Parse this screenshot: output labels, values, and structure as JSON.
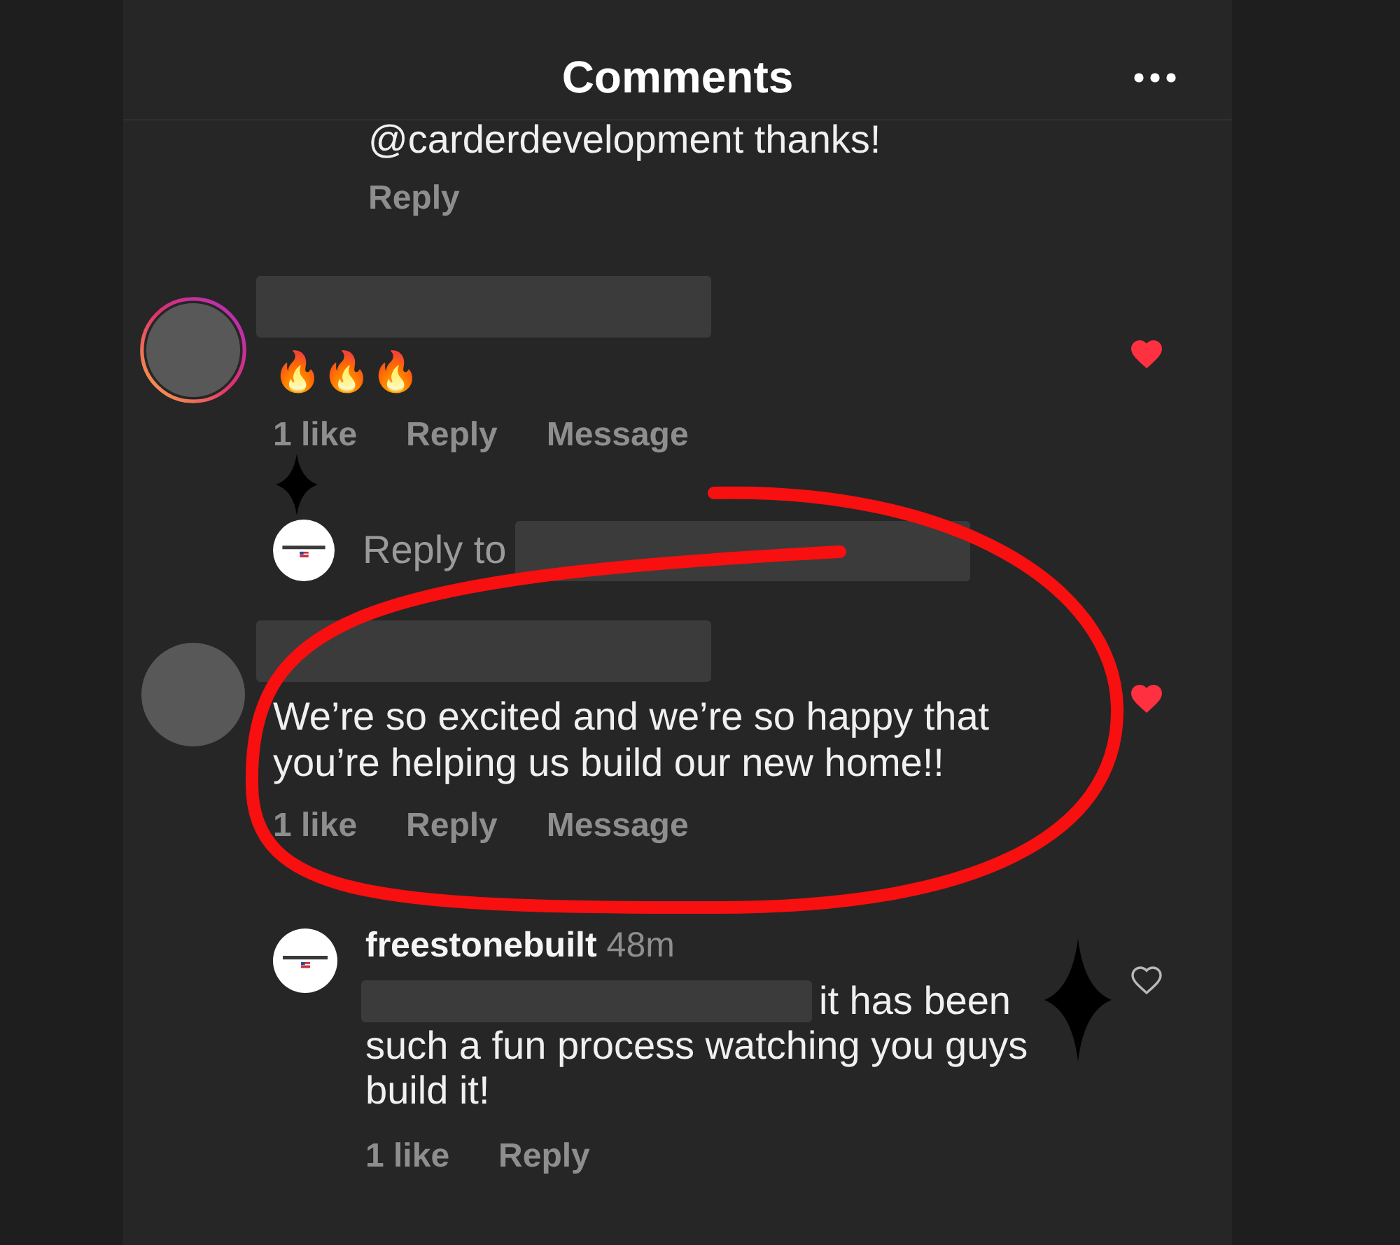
{
  "header": {
    "title": "Comments"
  },
  "comments": [
    {
      "kind": "reply_tail",
      "text": "@carderdevelopment thanks!",
      "actions": [
        "Reply"
      ]
    },
    {
      "kind": "comment",
      "author_hidden": true,
      "story_ring": true,
      "text": "🔥🔥🔥",
      "liked": true,
      "actions": [
        "1 like",
        "Reply",
        "Message"
      ]
    },
    {
      "kind": "reply_prompt",
      "label": "Reply to",
      "target_hidden": true
    },
    {
      "kind": "comment",
      "author_hidden": true,
      "story_ring": false,
      "text": "We’re so excited and we’re so happy that you’re helping us build our new home!!",
      "liked": true,
      "actions": [
        "1 like",
        "Reply",
        "Message"
      ]
    },
    {
      "kind": "reply",
      "author": "freestonebuilt",
      "time": "48m",
      "mention_hidden": true,
      "text": "it has been such a fun process watching you guys build it!",
      "liked": false,
      "actions": [
        "1 like",
        "Reply"
      ]
    }
  ]
}
